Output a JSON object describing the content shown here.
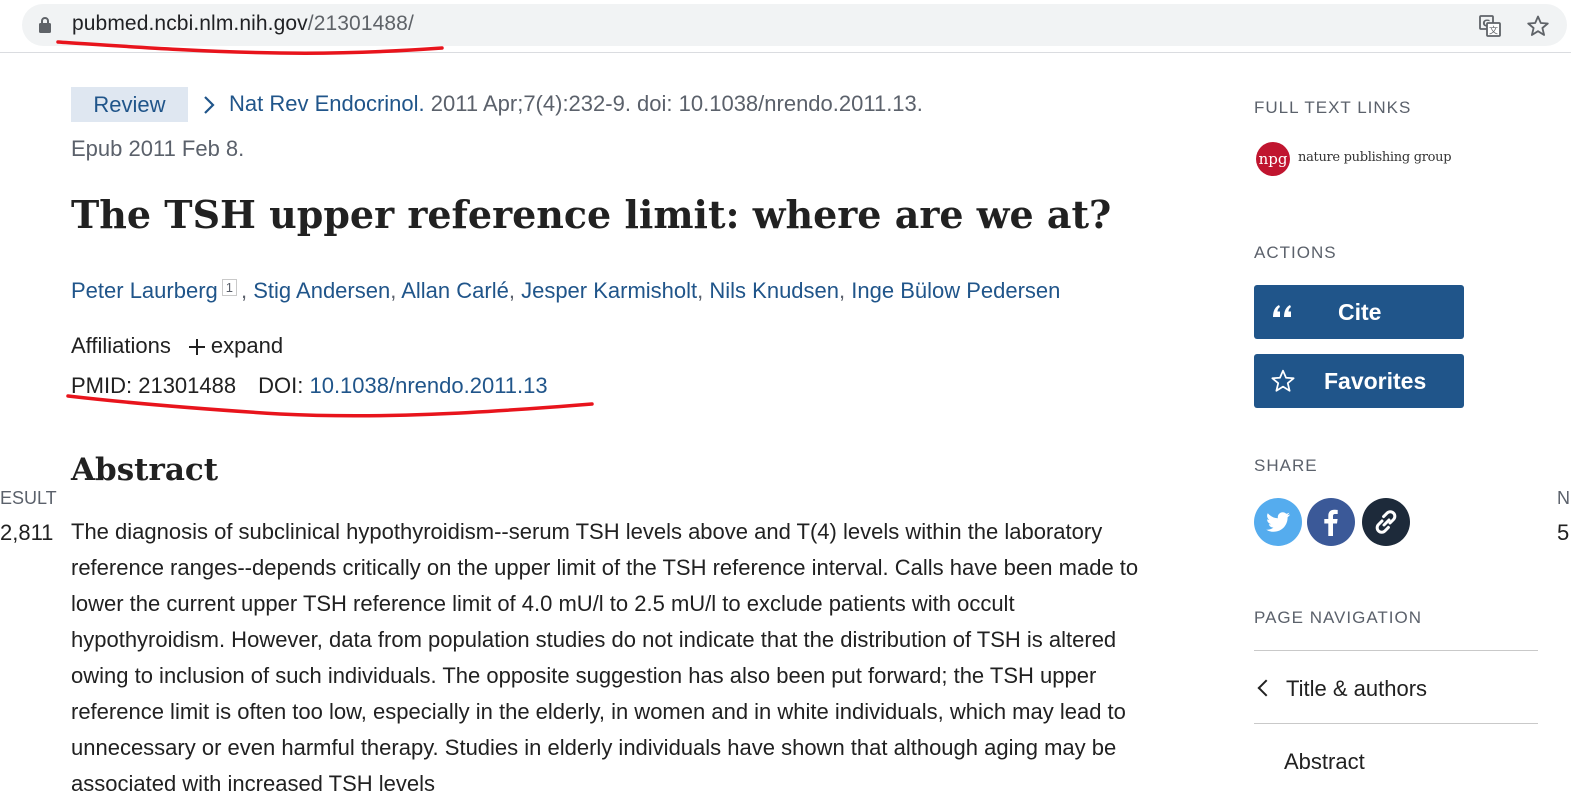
{
  "browser": {
    "url_host": "pubmed.ncbi.nlm.nih.gov",
    "url_path": "/21301488/",
    "icons": [
      "lock-icon",
      "translate-icon",
      "bookmark-star-icon"
    ]
  },
  "article": {
    "badge": "Review",
    "journal": "Nat Rev Endocrinol.",
    "citation": " 2011 Apr;7(4):232-9. doi: 10.1038/nrendo.2011.13.",
    "epub": "Epub 2011 Feb 8.",
    "title": "The TSH upper reference limit: where are we at?",
    "authors": [
      {
        "name": "Peter Laurberg",
        "sup": "1"
      },
      {
        "name": "Stig Andersen"
      },
      {
        "name": "Allan Carlé"
      },
      {
        "name": "Jesper Karmisholt"
      },
      {
        "name": "Nils Knudsen"
      },
      {
        "name": "Inge Bülow Pedersen"
      }
    ],
    "affiliations_label": "Affiliations",
    "expand_label": "expand",
    "pmid_label": "PMID: 21301488",
    "doi_label": "DOI:",
    "doi_value": "10.1038/nrendo.2011.13",
    "abstract_heading": "Abstract",
    "abstract_text": "The diagnosis of subclinical hypothyroidism--serum TSH levels above and T(4) levels within the laboratory reference ranges--depends critically on the upper limit of the TSH reference interval. Calls have been made to lower the current upper TSH reference limit of 4.0 mU/l to 2.5 mU/l to exclude patients with occult hypothyroidism. However, data from population studies do not indicate that the distribution of TSH is altered owing to inclusion of such individuals. The opposite suggestion has also been put forward; the TSH upper reference limit is often too low, especially in the elderly, in women and in white individuals, which may lead to unnecessary or even harmful therapy. Studies in elderly individuals have shown that although aging may be associated with increased TSH levels"
  },
  "edge": {
    "left_label": "ESULT",
    "left_value": "2,811",
    "right_label": "N",
    "right_value": "5"
  },
  "sidebar": {
    "full_text_heading": "FULL TEXT LINKS",
    "publisher_logo_text": "npg",
    "publisher_name": "nature publishing group",
    "actions_heading": "ACTIONS",
    "cite_label": "Cite",
    "favorites_label": "Favorites",
    "share_heading": "SHARE",
    "page_nav_heading": "PAGE NAVIGATION",
    "nav_items": [
      "Title & authors",
      "Abstract"
    ]
  },
  "colors": {
    "link": "#20558a",
    "button": "#20558a",
    "annotation_red": "#e8141c"
  }
}
